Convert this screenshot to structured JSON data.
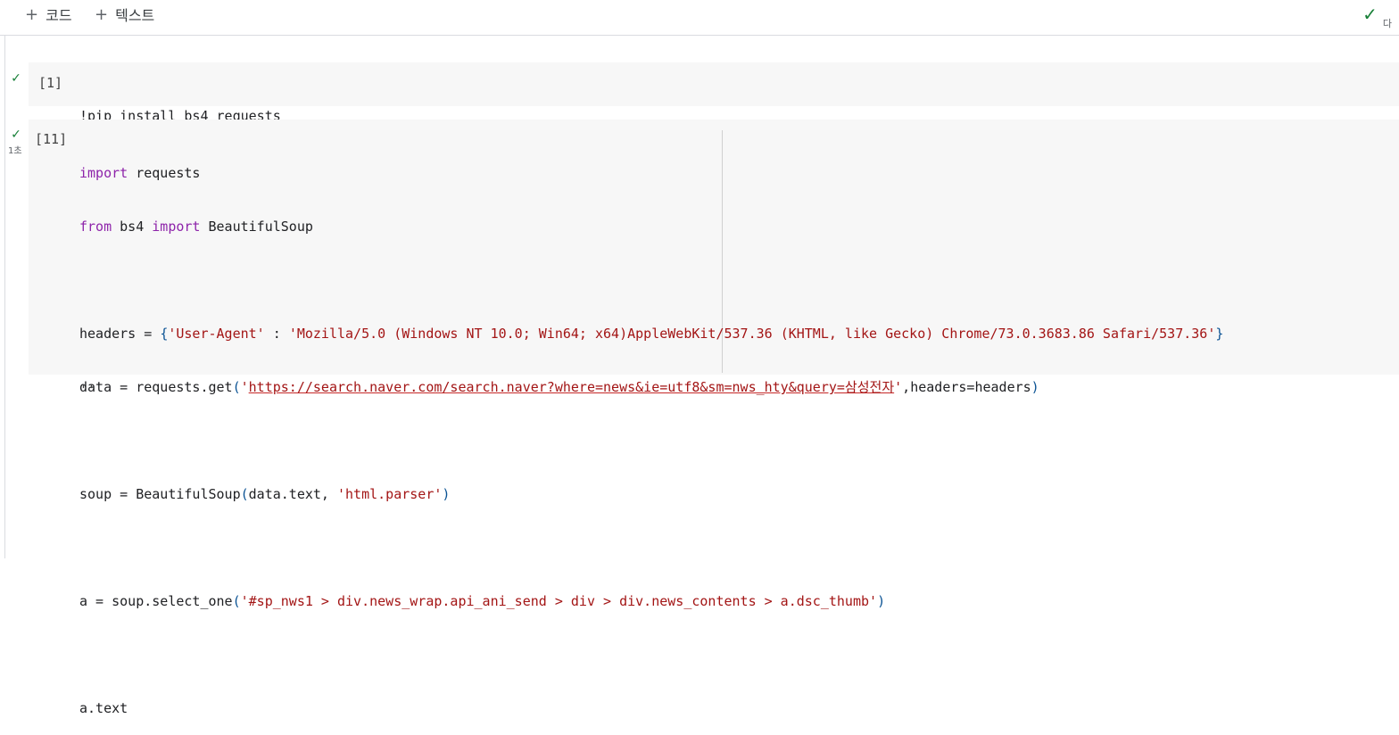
{
  "toolbar": {
    "add_code": "코드",
    "add_text": "텍스트",
    "status_label": "다"
  },
  "cells": {
    "c1": {
      "exec": "[1]",
      "code": "!pip install bs4 requests"
    },
    "c2": {
      "exec": "[11]",
      "time": "1초",
      "l1_kw": "import",
      "l1_rest": " requests",
      "l2_kw1": "from",
      "l2_mid": " bs4 ",
      "l2_kw2": "import",
      "l2_rest": " BeautifulSoup",
      "l4_a": "headers = ",
      "l4_b1": "{",
      "l4_s1": "'User-Agent'",
      "l4_c": " : ",
      "l4_s2": "'Mozilla/5.0 (Windows NT 10.0; Win64; x64)AppleWebKit/537.36 (KHTML, like Gecko) Chrome/73.0.3683.86 Safari/537.36'",
      "l4_b2": "}",
      "l5_a": "data = requests.get",
      "l5_b1": "(",
      "l5_q1": "'",
      "l5_url": "https://search.naver.com/search.naver?where=news&ie=utf8&sm=nws_hty&query=삼성전자",
      "l5_q2": "'",
      "l5_rest": ",headers=headers",
      "l5_b2": ")",
      "l7_a": "soup = BeautifulSoup",
      "l7_b1": "(",
      "l7_mid": "data.text, ",
      "l7_s": "'html.parser'",
      "l7_b2": ")",
      "l9_a": "a = soup.select_one",
      "l9_b1": "(",
      "l9_s": "'#sp_nws1 > div.news_wrap.api_ani_send > div > div.news_contents > a.dsc_thumb'",
      "l9_b2": ")",
      "l11": "a.text",
      "output": "''"
    }
  }
}
